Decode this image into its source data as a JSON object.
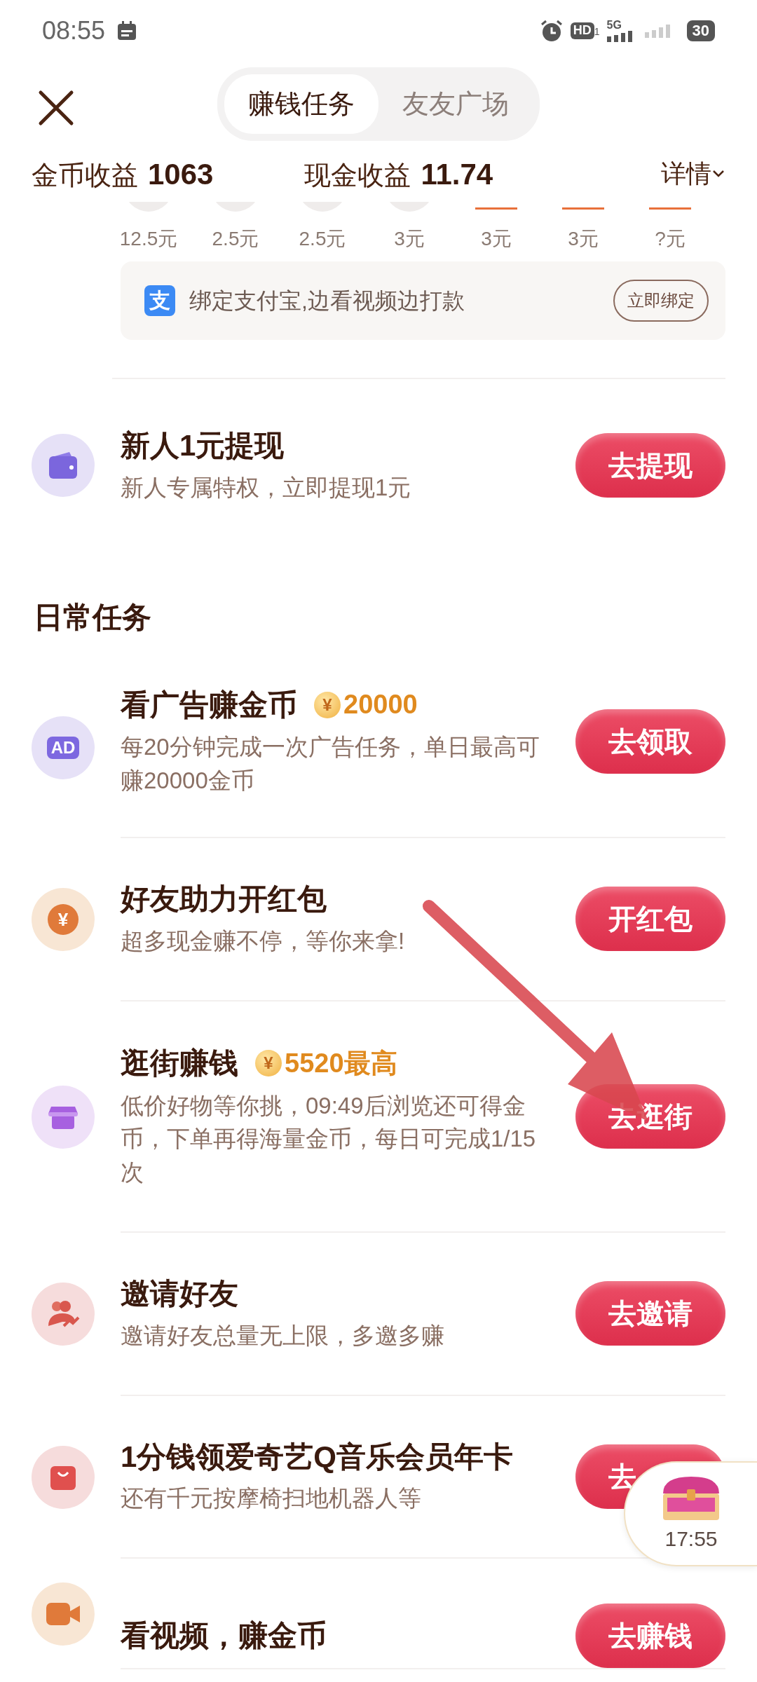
{
  "status_bar": {
    "time": "08:55",
    "hd": "HD",
    "sim_slot": "1",
    "network": "5G",
    "battery": "30"
  },
  "tabs": [
    {
      "label": "赚钱任务",
      "selected": true
    },
    {
      "label": "友友广场",
      "selected": false
    }
  ],
  "earnings": [
    {
      "label": "金币收益",
      "value": "1063"
    },
    {
      "label": "现金收益",
      "value": "11.74"
    }
  ],
  "details_link": "详情",
  "rewards": [
    {
      "amount": "12.5元",
      "highlighted": false
    },
    {
      "amount": "2.5元",
      "highlighted": false
    },
    {
      "amount": "2.5元",
      "highlighted": false
    },
    {
      "amount": "3元",
      "highlighted": false
    },
    {
      "amount": "3元",
      "highlighted": true
    },
    {
      "amount": "3元",
      "highlighted": true
    },
    {
      "amount": "?元",
      "highlighted": true
    }
  ],
  "alipay_banner": {
    "icon_label": "支",
    "text": "绑定支付宝,边看视频边打款",
    "button": "立即绑定"
  },
  "top_tasks": [
    {
      "kind": "wallet",
      "title": "新人1元提现",
      "subtitle": "新人专属特权，立即提现1元",
      "button": "去提现"
    }
  ],
  "daily_section": {
    "title": "日常任务",
    "tasks": [
      {
        "kind": "ad",
        "icon_label": "AD",
        "title": "看广告赚金币",
        "coin": {
          "symbol": "¥",
          "amount": "20000"
        },
        "subtitle": "每20分钟完成一次广告任务，单日最高可赚20000金币",
        "button": "去领取"
      },
      {
        "kind": "yuan",
        "icon_label": "¥",
        "title": "好友助力开红包",
        "subtitle": "超多现金赚不停，等你来拿!",
        "button": "开红包"
      },
      {
        "kind": "shop",
        "title": "逛街赚钱",
        "coin": {
          "symbol": "¥",
          "amount": "5520最高"
        },
        "subtitle": "低价好物等你挑，09:49后浏览还可得金币，下单再得海量金币，每日可完成1/15次",
        "button": "去逛街"
      },
      {
        "kind": "invite",
        "title": "邀请好友",
        "subtitle": "邀请好友总量无上限，多邀多赚",
        "button": "去邀请"
      },
      {
        "kind": "bag",
        "title": "1分钱领爱奇艺Q音乐会员年卡",
        "subtitle": "还有千元按摩椅扫地机器人等",
        "button": "去"
      },
      {
        "kind": "video",
        "title": "看视频，赚金币",
        "button": "去赚钱"
      }
    ]
  },
  "floating_widget": {
    "timer": "17:55"
  }
}
